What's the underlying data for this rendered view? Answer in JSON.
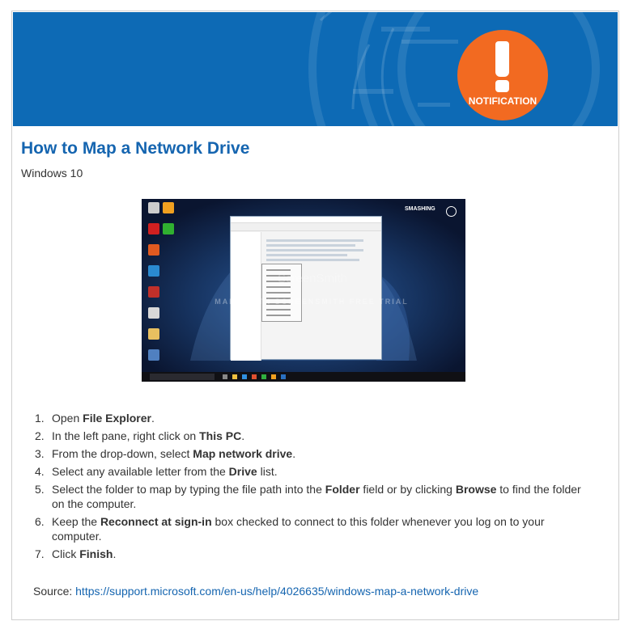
{
  "banner": {
    "badge_text": "NOTIFICATION",
    "badge_icon": "exclamation-icon",
    "colors": {
      "banner_blue": "#0d6ab5",
      "badge_orange": "#f26a21"
    }
  },
  "article": {
    "title": "How to Map a Network Drive",
    "subtitle": "Windows 10"
  },
  "screenshot": {
    "watermark_brand": "ScreenSmith",
    "watermark_banner": "MADE WITH SCREENSMITH FREE TRIAL",
    "logo": "SMASHING"
  },
  "steps": [
    {
      "number": "1.",
      "parts": [
        {
          "t": "Open "
        },
        {
          "b": "File Explorer"
        },
        {
          "t": "."
        }
      ]
    },
    {
      "number": "2.",
      "parts": [
        {
          "t": "In the left pane, right click on "
        },
        {
          "b": "This PC"
        },
        {
          "t": "."
        }
      ]
    },
    {
      "number": "3.",
      "parts": [
        {
          "t": "From the drop-down, select "
        },
        {
          "b": "Map network drive"
        },
        {
          "t": "."
        }
      ]
    },
    {
      "number": "4.",
      "parts": [
        {
          "t": "Select any available letter from the "
        },
        {
          "b": "Drive"
        },
        {
          "t": " list."
        }
      ]
    },
    {
      "number": "5.",
      "parts": [
        {
          "t": "Select the folder to map by typing the file path into the "
        },
        {
          "b": "Folder"
        },
        {
          "t": " field or by clicking "
        },
        {
          "b": "Browse"
        },
        {
          "t": " to find the folder on the computer."
        }
      ]
    },
    {
      "number": "6.",
      "parts": [
        {
          "t": "Keep the "
        },
        {
          "b": "Reconnect at sign-in"
        },
        {
          "t": " box checked to connect to this folder whenever you log on to your computer."
        }
      ]
    },
    {
      "number": "7.",
      "parts": [
        {
          "t": "Click "
        },
        {
          "b": "Finish"
        },
        {
          "t": "."
        }
      ]
    }
  ],
  "source": {
    "label": "Source: ",
    "link_text": "https://support.microsoft.com/en-us/help/4026635/windows-map-a-network-drive"
  }
}
